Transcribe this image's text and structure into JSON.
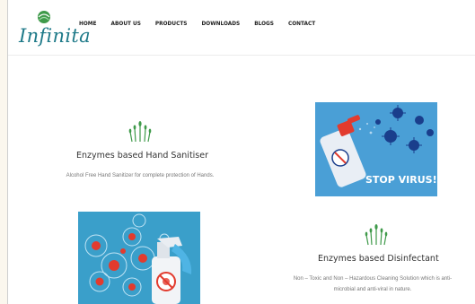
{
  "brand": {
    "logo_text": "Infinita"
  },
  "nav": {
    "items": [
      "HOME",
      "ABOUT US",
      "PRODUCTS",
      "DOWNLOADS",
      "BLOGS",
      "CONTACT"
    ]
  },
  "products": [
    {
      "title": "Enzymes based Hand Sanitiser",
      "description": "Alcohol Free Hand Sanitizer for complete protection of Hands.",
      "icon": "wheat-icon"
    },
    {
      "title": "Enzymes based Disinfectant",
      "description_line1": "Non – Toxic and Non – Hazardous Cleaning Solution which is anti-",
      "description_line2": "microbial and anti-viral in nature.",
      "icon": "wheat-icon"
    }
  ],
  "images": {
    "stop_virus_text": "STOP VIRUS!"
  },
  "colors": {
    "accent_green": "#3f9a4a",
    "image_blue": "#4a9fd6",
    "logo_teal": "#1f7a89"
  }
}
